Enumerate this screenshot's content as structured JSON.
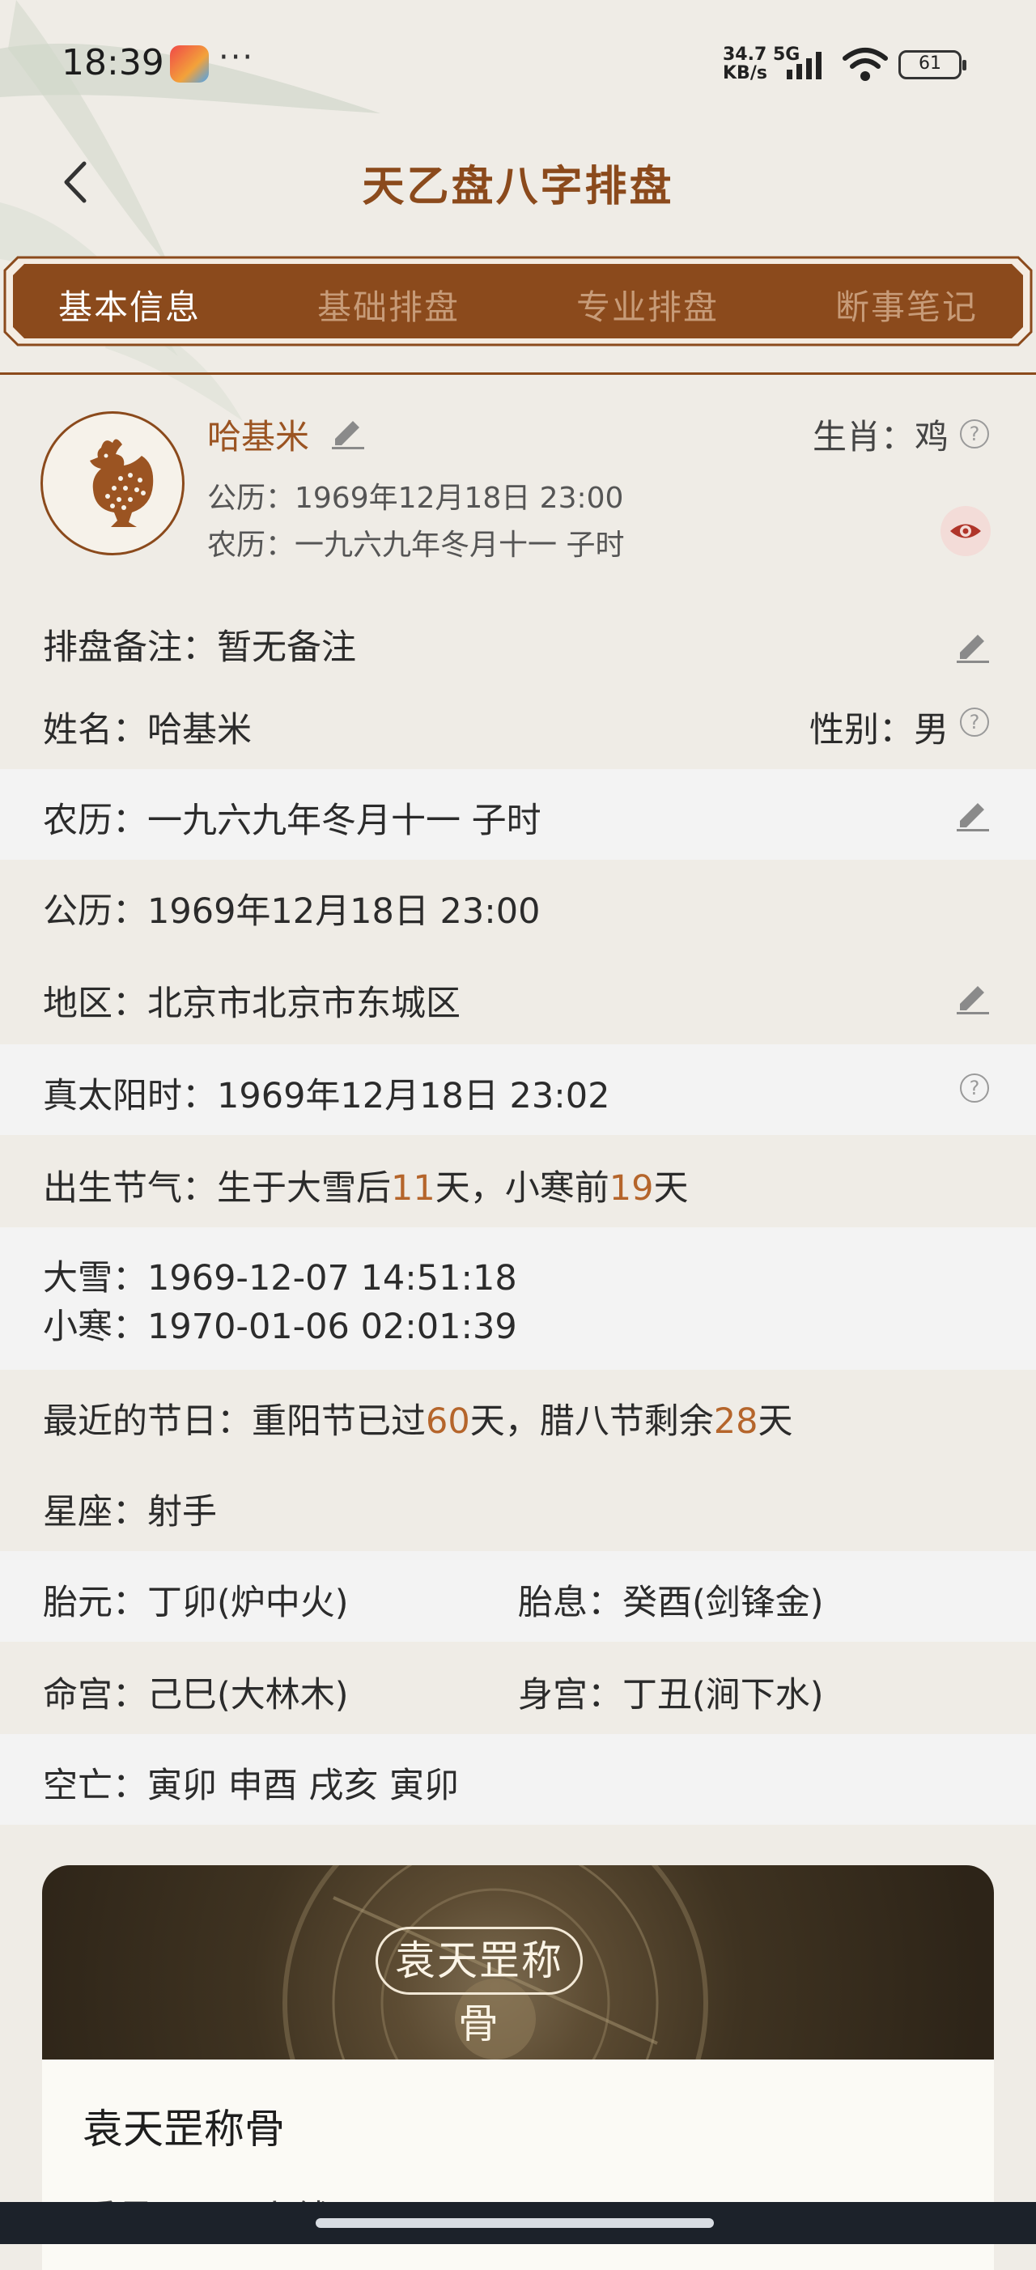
{
  "status_bar": {
    "time": "18:39",
    "more": "···",
    "net_speed_value": "34.7 5G",
    "net_speed_unit": "KB/s",
    "battery": "61"
  },
  "header": {
    "title": "天乙盘八字排盘",
    "back_icon": "chevron-left-icon"
  },
  "tabs": [
    {
      "label": "基本信息",
      "active": true
    },
    {
      "label": "基础排盘",
      "active": false
    },
    {
      "label": "专业排盘",
      "active": false
    },
    {
      "label": "断事笔记",
      "active": false
    }
  ],
  "profile": {
    "avatar_icon": "rooster-icon",
    "name": "哈基米",
    "solar": "公历：1969年12月18日 23:00",
    "lunar": "农历：一九六九年冬月十一  子时",
    "zodiac": "生肖：鸡"
  },
  "rows": {
    "note": "排盘备注：暂无备注",
    "name": "姓名：哈基米",
    "gender": "性别：男",
    "lunar": "农历：一九六九年冬月十一  子时",
    "solar": "公历：1969年12月18日 23:00",
    "region": "地区：北京市北京市东城区",
    "true_solar": "真太阳时：1969年12月18日 23:02",
    "solar_term": {
      "prefix": "出生节气：生于大雪后",
      "d1": "11",
      "mid": "天，小寒前",
      "d2": "19",
      "suffix": "天"
    },
    "daxue": "大雪：1969-12-07 14:51:18",
    "xiaohan": "小寒：1970-01-06 02:01:39",
    "festival": {
      "prefix": "最近的节日：重阳节已过",
      "d1": "60",
      "mid": "天，腊八节剩余",
      "d2": "28",
      "suffix": "天"
    },
    "constellation": "星座：射手",
    "taiyuan": "胎元：丁卯(炉中火)",
    "taixi": "胎息：癸酉(剑锋金)",
    "minggong": "命宫：己巳(大林木)",
    "shengong": "身宫：丁丑(涧下水)",
    "kongwang": "空亡：寅卯 申酉 戌亥 寅卯"
  },
  "card": {
    "banner_title": "袁天罡称骨",
    "title": "袁天罡称骨",
    "subtitle": "重量：三两九钱"
  }
}
